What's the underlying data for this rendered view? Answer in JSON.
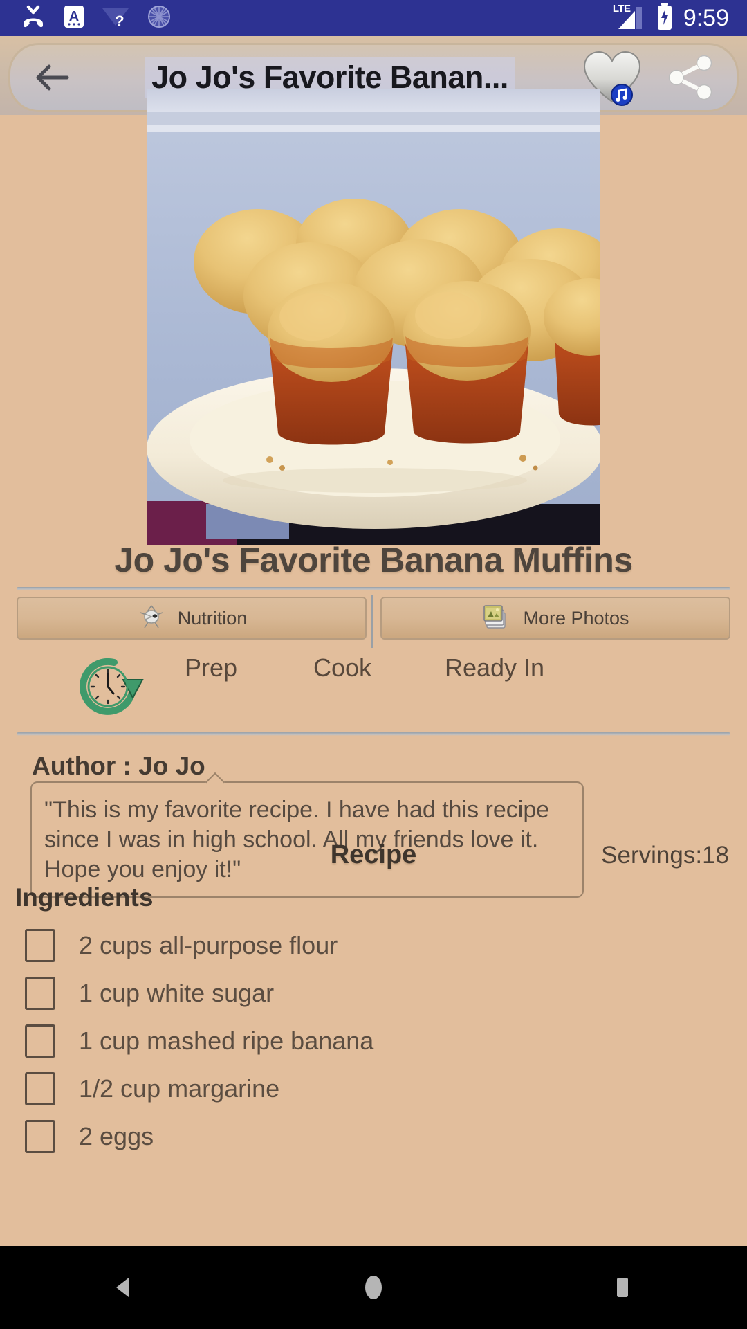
{
  "statusbar": {
    "time": "9:59",
    "network_label": "LTE",
    "icons": [
      {
        "name": "missed-call-icon"
      },
      {
        "name": "keyboard-language-icon",
        "glyph": "A"
      },
      {
        "name": "wifi-question-icon",
        "glyph": "?"
      },
      {
        "name": "sync-spinner-icon"
      }
    ],
    "right_icons": [
      {
        "name": "signal-bars-icon"
      },
      {
        "name": "battery-charging-icon"
      }
    ],
    "background": "#2D3292"
  },
  "header": {
    "back_label": "Back",
    "title": "Jo Jo's Favorite Banan...",
    "favorite_label": "Favorite",
    "share_label": "Share",
    "favorite_active": false
  },
  "hero": {
    "alt": "Banana muffins on a white plate",
    "name": "recipe-hero-photo"
  },
  "recipe": {
    "title": "Jo Jo's Favorite Banana Muffins",
    "section_label": "Recipe",
    "servings": "Servings:18",
    "ingredients_label": "Ingredients"
  },
  "buttons": {
    "nutrition": "Nutrition",
    "more_photos": "More Photos"
  },
  "times": {
    "prep_label": "Prep",
    "cook_label": "Cook",
    "ready_label": "Ready In",
    "prep_value": "",
    "cook_value": "",
    "ready_value": ""
  },
  "author": {
    "label": "Author : Jo Jo",
    "quote": "\"This is my favorite recipe. I have had this recipe since I was in high school. All my friends love it. Hope you enjoy it!\""
  },
  "ingredients": [
    {
      "text": "2 cups all-purpose flour",
      "checked": false
    },
    {
      "text": "1 cup white sugar",
      "checked": false
    },
    {
      "text": "1 cup mashed ripe banana",
      "checked": false
    },
    {
      "text": "1/2 cup margarine",
      "checked": false
    },
    {
      "text": "2 eggs",
      "checked": false
    }
  ],
  "navbar": {
    "back": "Back",
    "home": "Home",
    "recents": "Recents"
  },
  "colors": {
    "status_bar": "#2D3292",
    "page_background": "#E2BE9C",
    "text_primary": "#4E453D",
    "text_secondary": "#5B4D41",
    "divider": "#9AA0A6",
    "button_face": "#D8B794",
    "clock_icon": "#3F9A6B"
  }
}
